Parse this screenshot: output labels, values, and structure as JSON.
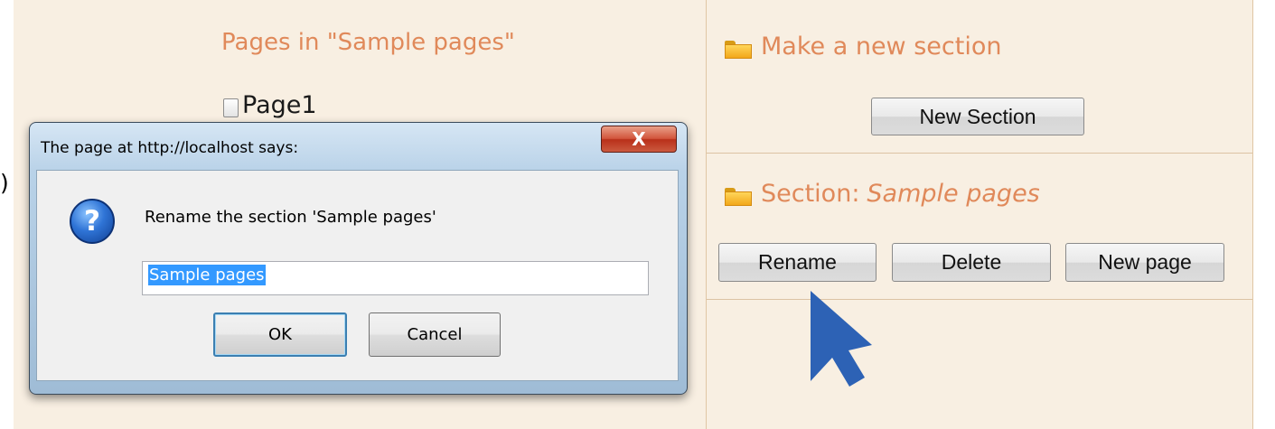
{
  "main": {
    "pages_heading": "Pages in \"Sample pages\"",
    "pages": [
      {
        "label": "Page1"
      }
    ],
    "stray_text": ")"
  },
  "sidebar": {
    "new_section": {
      "title": "Make a new section",
      "button_label": "New Section"
    },
    "section": {
      "title_prefix": "Section:",
      "name": "Sample pages",
      "rename_label": "Rename",
      "delete_label": "Delete",
      "new_page_label": "New page"
    }
  },
  "dialog": {
    "title": "The page at http://localhost says:",
    "close_label": "X",
    "icon": "question-icon",
    "message": "Rename the section 'Sample pages'",
    "input_value": "Sample pages",
    "ok_label": "OK",
    "cancel_label": "Cancel"
  },
  "colors": {
    "panel_bg": "#f8efe2",
    "heading_orange": "#e0895a",
    "cursor_blue": "#2d62b5",
    "selection_blue": "#3399ff"
  }
}
